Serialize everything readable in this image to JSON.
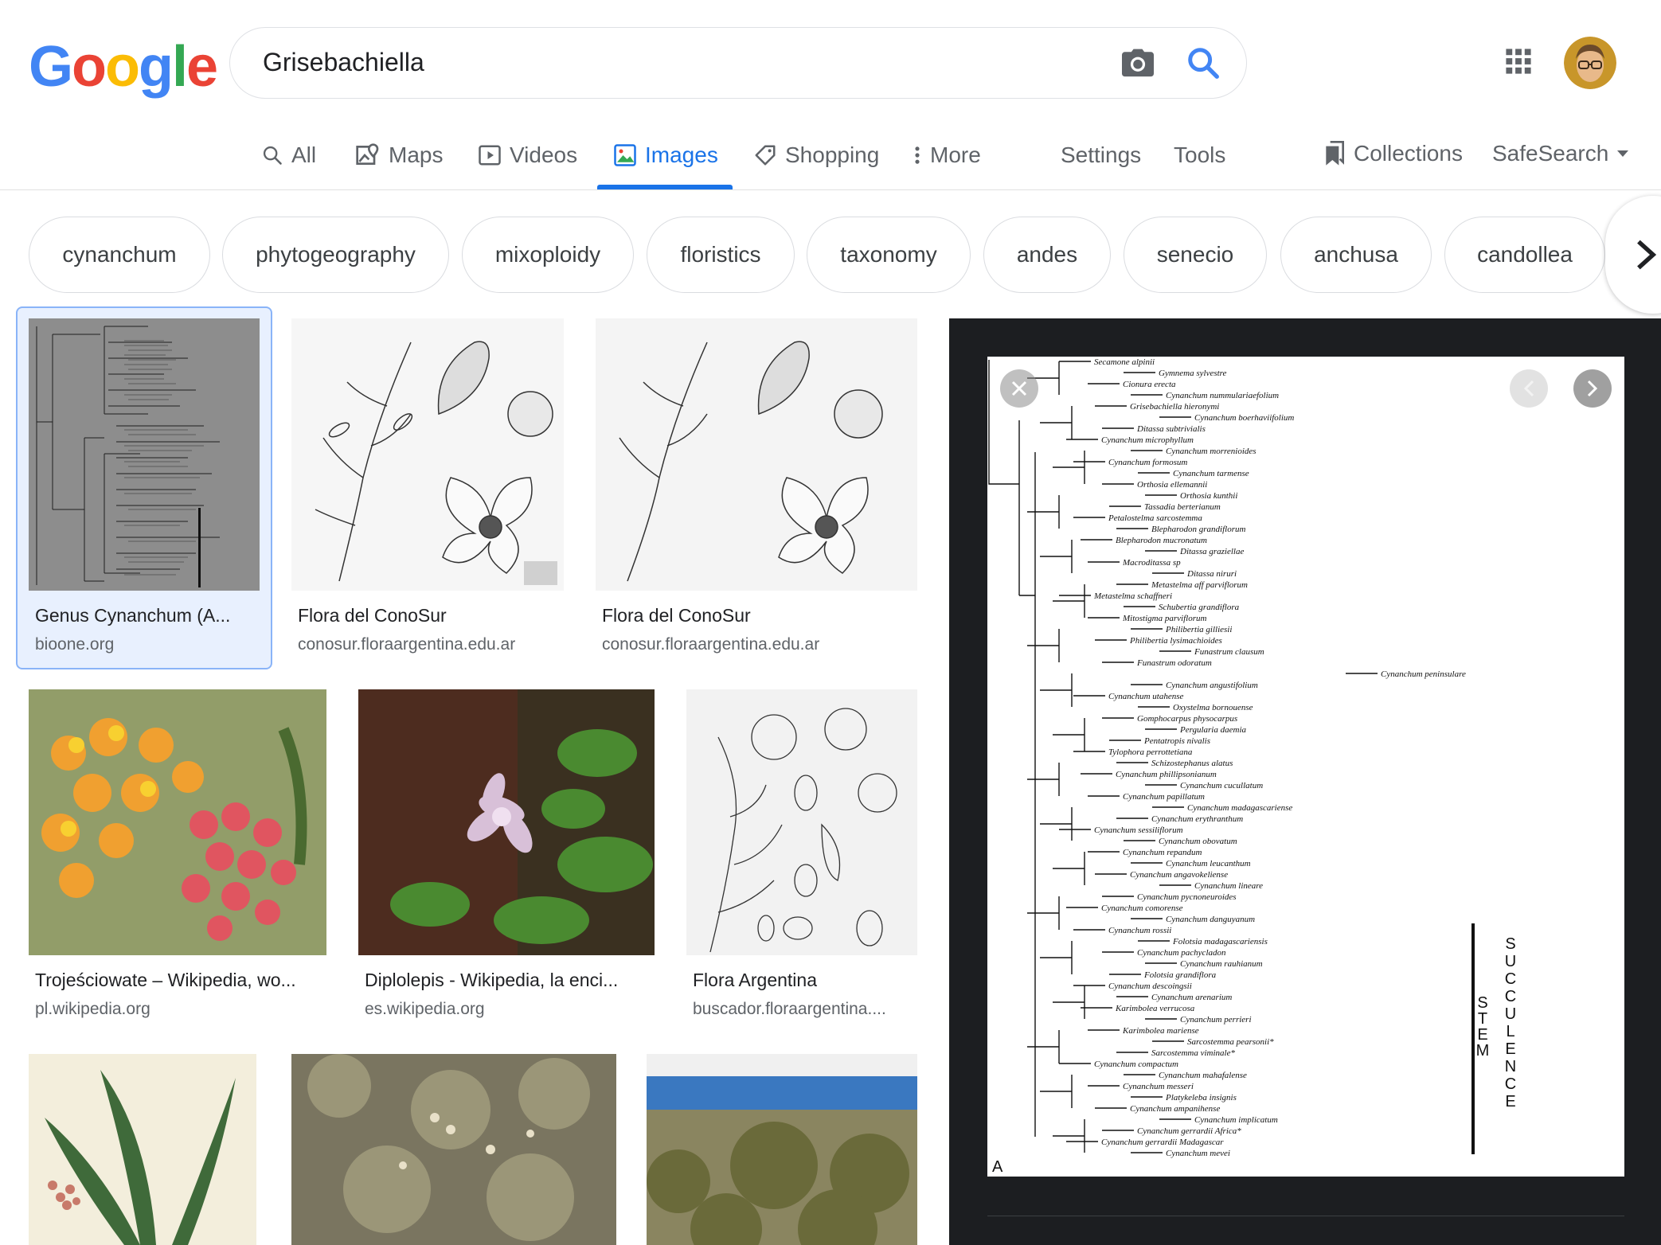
{
  "brand": {
    "logo_letters": [
      "G",
      "o",
      "o",
      "g",
      "l",
      "e"
    ],
    "logo_colors": [
      "#4285F4",
      "#EA4335",
      "#FBBC05",
      "#4285F4",
      "#34A853",
      "#EA4335"
    ]
  },
  "search": {
    "query": "Grisebachiella"
  },
  "tabs": [
    {
      "label": "All",
      "icon": "search-icon"
    },
    {
      "label": "Maps",
      "icon": "map-pin-icon"
    },
    {
      "label": "Videos",
      "icon": "play-icon"
    },
    {
      "label": "Images",
      "icon": "image-icon",
      "active": true
    },
    {
      "label": "Shopping",
      "icon": "tag-icon"
    },
    {
      "label": "More",
      "icon": "more-vert-icon"
    }
  ],
  "tools": {
    "settings": "Settings",
    "tools": "Tools",
    "collections": "Collections",
    "safesearch": "SafeSearch"
  },
  "chips": [
    "cynanchum",
    "phytogeography",
    "mixoploidy",
    "floristics",
    "taxonomy",
    "andes",
    "senecio",
    "anchusa",
    "candollea"
  ],
  "results": [
    {
      "title": "Genus Cynanchum (A...",
      "source": "bioone.org",
      "selected": true
    },
    {
      "title": "Flora del ConoSur",
      "source": "conosur.floraargentina.edu.ar"
    },
    {
      "title": "Flora del ConoSur",
      "source": "conosur.floraargentina.edu.ar"
    },
    {
      "title": "Trojeściowate – Wikipedia, wo...",
      "source": "pl.wikipedia.org"
    },
    {
      "title": "Diplolepis - Wikipedia, la enci...",
      "source": "es.wikipedia.org"
    },
    {
      "title": "Flora Argentina",
      "source": "buscador.floraargentina...."
    }
  ],
  "preview": {
    "panel_label": "A",
    "sidebar_letters_left": "STEM",
    "sidebar_letters_right": "SUCCULENCE",
    "taxa": [
      "Secamone alpinii",
      "Gymnema sylvestre",
      "Cionura erecta",
      "Cynanchum nummulariaefolium",
      "Grisebachiella hieronymi",
      "Cynanchum boerhaviifolium",
      "Ditassa subtrivialis",
      "Cynanchum microphyllum",
      "Cynanchum morrenioides",
      "Cynanchum formosum",
      "Cynanchum tarmense",
      "Orthosia ellemannii",
      "Orthosia kunthii",
      "Tassadia berterianum",
      "Petalostelma sarcostemma",
      "Blepharodon grandiflorum",
      "Blepharodon mucronatum",
      "Ditassa graziellae",
      "Macroditassa sp",
      "Ditassa niruri",
      "Metastelma aff parviflorum",
      "Metastelma schaffneri",
      "Schubertia grandiflora",
      "Mitostigma parviflorum",
      "Philibertia gilliesii",
      "Philibertia lysimachioides",
      "Funastrum clausum",
      "Funastrum odoratum",
      "Cynanchum peninsulare",
      "Cynanchum angustifolium",
      "Cynanchum utahense",
      "Oxystelma bornouense",
      "Gomphocarpus physocarpus",
      "Pergularia daemia",
      "Pentatropis nivalis",
      "Tylophora perrottetiana",
      "Schizostephanus alatus",
      "Cynanchum phillipsonianum",
      "Cynanchum cucullatum",
      "Cynanchum papillatum",
      "Cynanchum madagascariense",
      "Cynanchum erythranthum",
      "Cynanchum sessiliflorum",
      "Cynanchum obovatum",
      "Cynanchum repandum",
      "Cynanchum leucanthum",
      "Cynanchum angavokeliense",
      "Cynanchum lineare",
      "Cynanchum pycnoneuroides",
      "Cynanchum comorense",
      "Cynanchum danguyanum",
      "Cynanchum rossii",
      "Folotsia madagascariensis",
      "Cynanchum pachycladon",
      "Cynanchum rauhianum",
      "Folotsia grandiflora",
      "Cynanchum descoingsii",
      "Cynanchum arenarium",
      "Karimbolea verrucosa",
      "Cynanchum perrieri",
      "Karimbolea mariense",
      "Sarcostemma pearsonii*",
      "Sarcostemma viminale*",
      "Cynanchum compactum",
      "Cynanchum mahafalense",
      "Cynanchum messeri",
      "Platykeleba insignis",
      "Cynanchum ampanihense",
      "Cynanchum implicatum",
      "Cynanchum gerrardii Africa*",
      "Cynanchum gerrardii Madagascar",
      "Cynanchum mevei"
    ]
  },
  "colors": {
    "accent": "#1a73e8",
    "panel_bg": "#1c1e21"
  }
}
